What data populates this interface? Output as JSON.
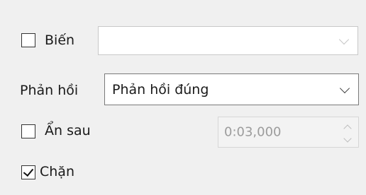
{
  "variable": {
    "checkbox_checked": false,
    "label": "Biến",
    "dropdown_value": ""
  },
  "feedback": {
    "label": "Phản hồi",
    "dropdown_value": "Phản hồi đúng"
  },
  "hide_after": {
    "checkbox_checked": false,
    "label": "Ẩn sau",
    "time_value": "0:03,000"
  },
  "block": {
    "checkbox_checked": true,
    "label": "Chặn"
  },
  "colors": {
    "background": "#f0f0f0",
    "field_border_enabled": "#7a7a7a",
    "field_border_disabled": "#c8c8c8",
    "disabled_text": "#9c9c9c"
  }
}
